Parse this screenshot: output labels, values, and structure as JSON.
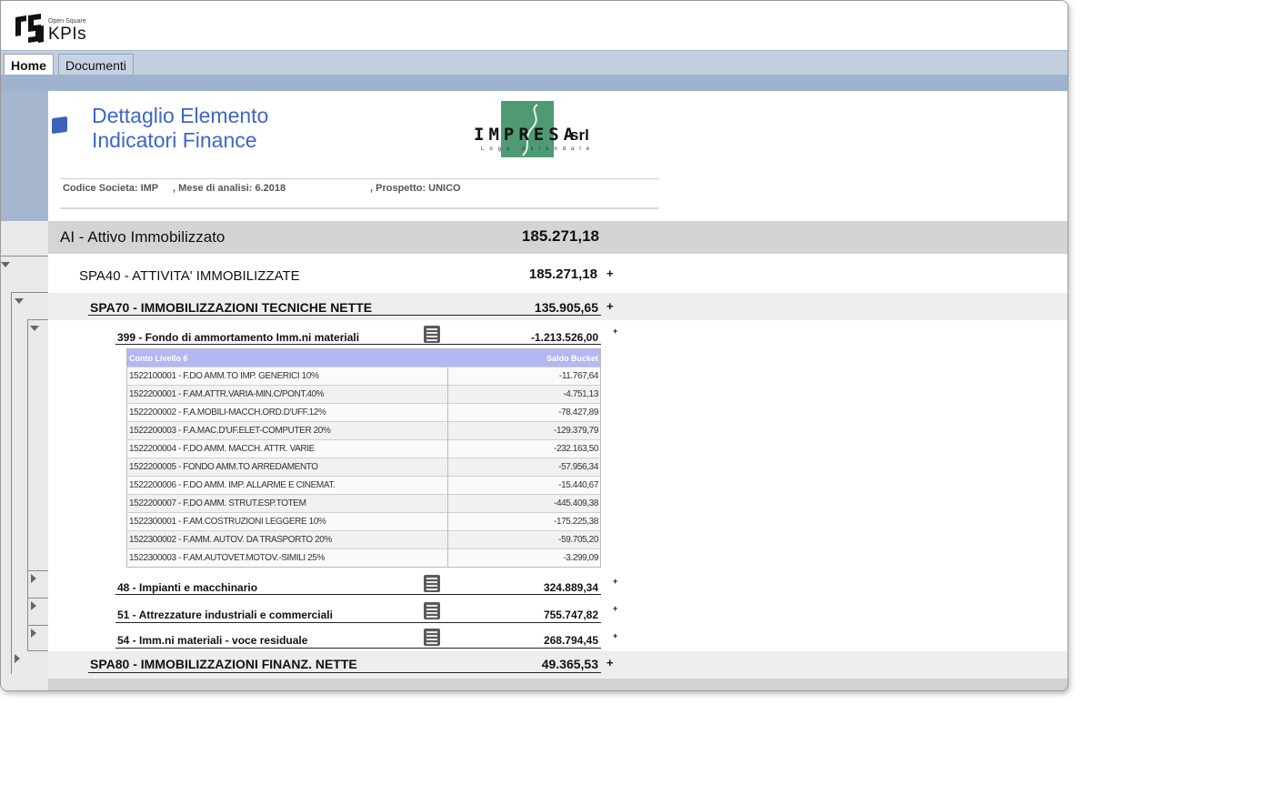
{
  "logo": {
    "small": "Open Square",
    "main": "KPIs"
  },
  "tabs": [
    {
      "label": "Home"
    },
    {
      "label": "Documenti"
    }
  ],
  "header": {
    "title_line1": "Dettaglio Elemento",
    "title_line2": "Indicatori Finance",
    "company_logo": {
      "text": "IMPRESA",
      "suffix": "srl",
      "subtext": "Logo Aziendale"
    },
    "codice_societa": "Codice Societa:  IMP",
    "mese_analisi": ", Mese di analisi: 6.2018",
    "prospetto": ", Prospetto: UNICO"
  },
  "rows": {
    "ai": {
      "label": "AI - Attivo Immobilizzato",
      "value": "185.271,18"
    },
    "spa40": {
      "label": "SPA40 - ATTIVITA' IMMOBILIZZATE",
      "value": "185.271,18",
      "plus": "+"
    },
    "spa70": {
      "label": "SPA70 - IMMOBILIZZAZIONI TECNICHE NETTE",
      "value": "135.905,65",
      "plus": "+"
    },
    "r399": {
      "label": "399 - Fondo di ammortamento Imm.ni materiali",
      "value": "-1.213.526,00",
      "plus": "+"
    },
    "r48": {
      "label": "48 - Impianti e macchinario",
      "value": "324.889,34",
      "plus": "+"
    },
    "r51": {
      "label": "51 - Attrezzature industriali e commerciali",
      "value": "755.747,82",
      "plus": "+"
    },
    "r54": {
      "label": "54 - Imm.ni materiali - voce residuale",
      "value": "268.794,45",
      "plus": "+"
    },
    "spa80": {
      "label": "SPA80 - IMMOBILIZZAZIONI FINANZ. NETTE",
      "value": "49.365,53",
      "plus": "+"
    }
  },
  "detail_table": {
    "columns": [
      "Conto Livello 6",
      "Saldo Bucket"
    ],
    "rows": [
      [
        "1522100001 - F.DO AMM.TO IMP. GENERICI 10%",
        "-11.767,64"
      ],
      [
        "1522200001 - F.AM.ATTR.VARIA-MIN.C/PONT.40%",
        "-4.751,13"
      ],
      [
        "1522200002 - F.A.MOBILI-MACCH.ORD.D'UFF.12%",
        "-78.427,89"
      ],
      [
        "1522200003 - F.A.MAC.D'UF.ELET-COMPUTER 20%",
        "-129.379,79"
      ],
      [
        "1522200004 - F.DO AMM. MACCH. ATTR. VARIE",
        "-232.163,50"
      ],
      [
        "1522200005 - FONDO AMM.TO ARREDAMENTO",
        "-57.956,34"
      ],
      [
        "1522200006 - F.DO AMM. IMP. ALLARME E CINEMAT.",
        "-15.440,67"
      ],
      [
        "1522200007 - F.DO AMM. STRUT.ESP.TOTEM",
        "-445.409,38"
      ],
      [
        "1522300001 - F.AM.COSTRUZIONI LEGGERE 10%",
        "-175.225,38"
      ],
      [
        "1522300002 - F.AMM. AUTOV. DA TRASPORTO 20%",
        "-59.705,20"
      ],
      [
        "1522300003 - F.AM.AUTOVET.MOTOV.-SIMILI 25%",
        "-3.299,09"
      ]
    ]
  },
  "colors": {
    "title_blue": "#3d67c3",
    "tab_bar": "#c2cfdf",
    "blue_strip": "#9fb2cf",
    "table_header": "#b3b7f2",
    "logo_green": "#4f9a73"
  }
}
